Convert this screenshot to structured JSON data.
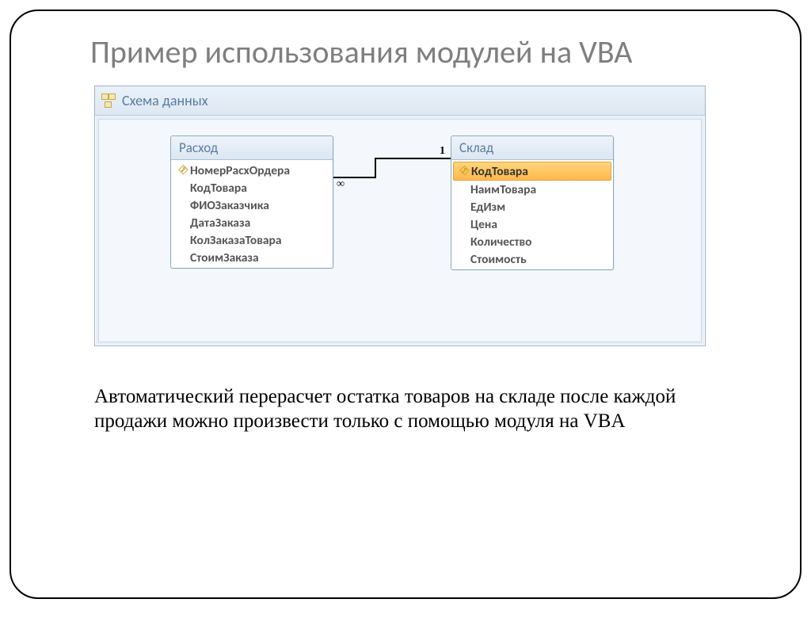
{
  "slide": {
    "title": "Пример использования модулей на VBA"
  },
  "window": {
    "title": "Схема данных"
  },
  "relationship": {
    "left_label": "∞",
    "right_label": "1"
  },
  "tables": {
    "left": {
      "title": "Расход",
      "fields": [
        {
          "name": "НомерРасхОрдера",
          "key": true,
          "selected": false
        },
        {
          "name": "КодТовара",
          "key": false,
          "selected": false
        },
        {
          "name": "ФИОЗаказчика",
          "key": false,
          "selected": false
        },
        {
          "name": "ДатаЗаказа",
          "key": false,
          "selected": false
        },
        {
          "name": "КолЗаказаТовара",
          "key": false,
          "selected": false
        },
        {
          "name": "СтоимЗаказа",
          "key": false,
          "selected": false
        }
      ]
    },
    "right": {
      "title": "Склад",
      "fields": [
        {
          "name": "КодТовара",
          "key": true,
          "selected": true
        },
        {
          "name": "НаимТовара",
          "key": false,
          "selected": false
        },
        {
          "name": "ЕдИзм",
          "key": false,
          "selected": false
        },
        {
          "name": "Цена",
          "key": false,
          "selected": false
        },
        {
          "name": "Количество",
          "key": false,
          "selected": false
        },
        {
          "name": "Стоимость",
          "key": false,
          "selected": false
        }
      ]
    }
  },
  "caption": "Автоматический перерасчет остатка товаров на складе после каждой продажи можно произвести только с помощью модуля на VBA"
}
